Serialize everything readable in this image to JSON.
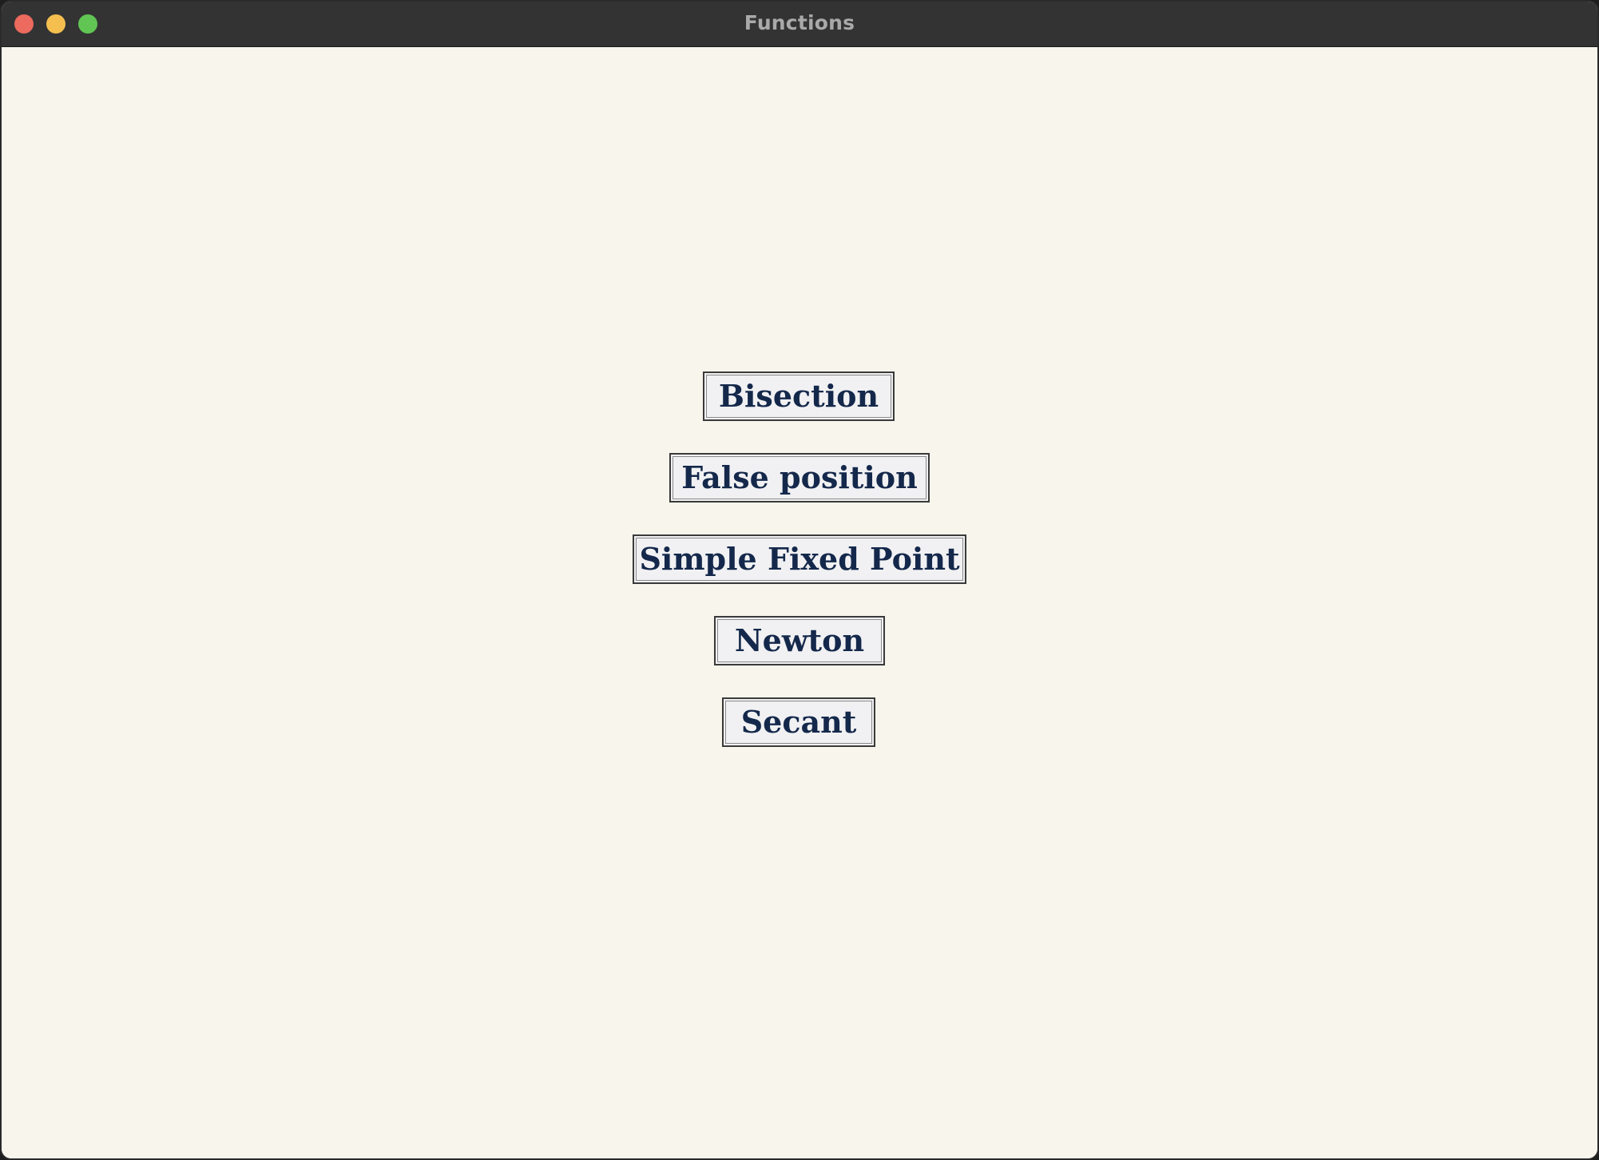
{
  "window": {
    "title": "Functions",
    "controls": {
      "close_color": "#ed6a5e",
      "minimize_color": "#f5bf4f",
      "zoom_color": "#61c554"
    }
  },
  "methods": [
    {
      "label": "Bisection"
    },
    {
      "label": "False position"
    },
    {
      "label": "Simple Fixed Point"
    },
    {
      "label": "Newton"
    },
    {
      "label": "Secant"
    }
  ],
  "colors": {
    "background": "#f8f5ec",
    "titlebar": "#333333",
    "button_text": "#14284b",
    "button_face": "#f1f1f3"
  }
}
